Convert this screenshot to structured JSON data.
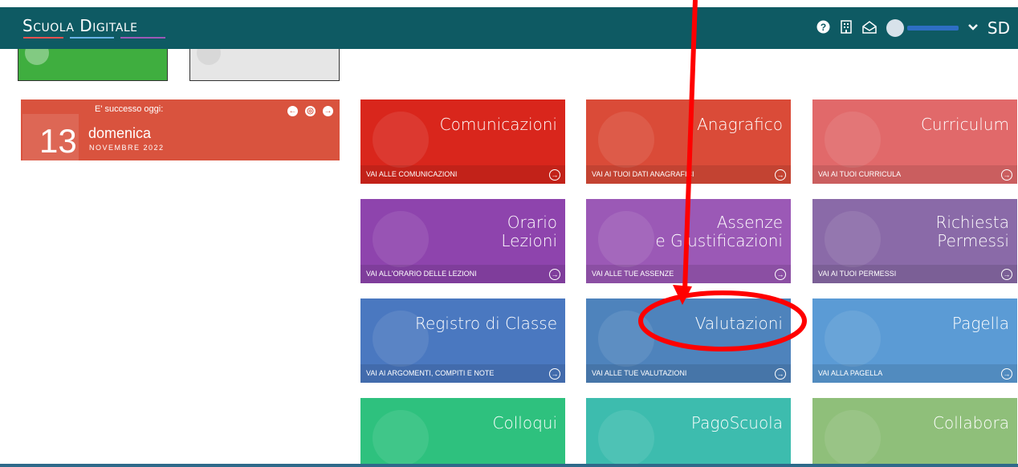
{
  "header": {
    "brand": "Scuola Digitale",
    "brand_short": "SD",
    "icons": [
      "help-icon",
      "building-icon",
      "mail-icon",
      "avatar",
      "chevron-down-icon"
    ]
  },
  "today": {
    "label": "E' successo oggi:",
    "day_number": "13",
    "weekday": "domenica",
    "month_year": "NOVEMBRE 2022"
  },
  "tiles": [
    {
      "title": "Comunicazioni",
      "footer": "VAI ALLE COMUNICAZIONI",
      "color": "#d9261c"
    },
    {
      "title": "Anagrafico",
      "footer": "VAI AI TUOI DATI ANAGRAFICI",
      "color": "#da4b38"
    },
    {
      "title": "Curriculum",
      "footer": "VAI AI TUOI CURRICULA",
      "color": "#e1696a"
    },
    {
      "title_line1": "Orario",
      "title_line2": "Lezioni",
      "footer": "VAI ALL'ORARIO DELLE LEZIONI",
      "color": "#8e44ad"
    },
    {
      "title_line1": "Assenze",
      "title_line2": "e Giustificazioni",
      "footer": "VAI ALLE TUE ASSENZE",
      "color": "#9b59b6"
    },
    {
      "title_line1": "Richiesta",
      "title_line2": "Permessi",
      "footer": "VAI AI TUOI PERMESSI",
      "color": "#8a6aa8"
    },
    {
      "title": "Registro di Classe",
      "footer": "VAI AI ARGOMENTI, COMPITI E NOTE",
      "color": "#4a78c0"
    },
    {
      "title": "Valutazioni",
      "footer": "VAI ALLE TUE VALUTAZIONI",
      "color": "#4e83bc"
    },
    {
      "title": "Pagella",
      "footer": "VAI ALLA PAGELLA",
      "color": "#5b9bd5"
    },
    {
      "title": "Colloqui",
      "footer": "",
      "color": "#2ec17e"
    },
    {
      "title": "PagoScuola",
      "footer": "",
      "color": "#3dbcae"
    },
    {
      "title": "Collabora",
      "footer": "",
      "color": "#8fbf7a"
    }
  ],
  "annotation": {
    "color": "#ff0000"
  }
}
